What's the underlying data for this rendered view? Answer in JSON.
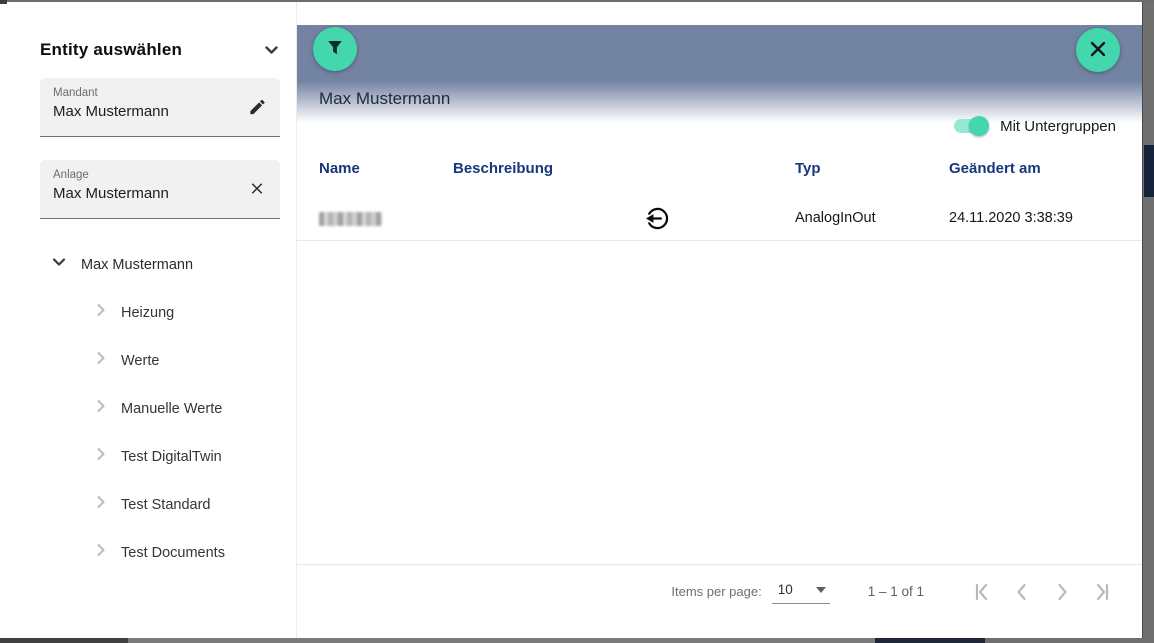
{
  "colors": {
    "accent": "#44d7ae",
    "bar": "#7383a2",
    "header_text": "#18387a"
  },
  "sidebar": {
    "title": "Entity auswählen",
    "mandant": {
      "label": "Mandant",
      "value": "Max Mustermann"
    },
    "anlage": {
      "label": "Anlage",
      "value": "Max Mustermann"
    },
    "tree": {
      "root": "Max Mustermann",
      "children": [
        "Heizung",
        "Werte",
        "Manuelle Werte",
        "Test DigitalTwin",
        "Test Standard",
        "Test Documents"
      ]
    }
  },
  "main": {
    "title": "Max Mustermann",
    "subgroups_toggle": {
      "label": "Mit Untergruppen",
      "state": "on"
    },
    "table": {
      "headers": {
        "name": "Name",
        "beschreibung": "Beschreibung",
        "typ": "Typ",
        "geaendert": "Geändert am"
      },
      "row": {
        "name_redacted": true,
        "beschreibung_icon": "logout-arrow-icon",
        "typ": "AnalogInOut",
        "geaendert": "24.11.2020 3:38:39"
      }
    },
    "paginator": {
      "items_per_page_label": "Items per page:",
      "items_per_page": "10",
      "range": "1 – 1 of 1"
    }
  }
}
